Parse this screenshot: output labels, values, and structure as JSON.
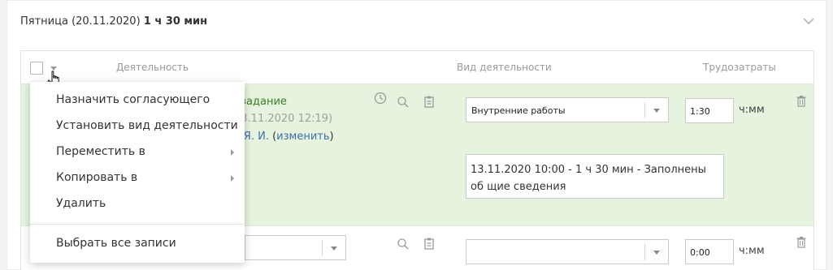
{
  "day": {
    "title_prefix": "Пятница (20.11.2020)",
    "title_total": "1 ч 30 мин"
  },
  "table": {
    "headers": {
      "activity": "Деятельность",
      "activity_type": "Вид деятельности",
      "labor": "Трудозатраты"
    }
  },
  "rows": [
    {
      "task_name_partial": "е задание",
      "task_date_partial": "13.11.2020 12:19)",
      "author_partial": "в Я. И.",
      "author_open_paren": " (",
      "change_link": "изменить",
      "author_close_paren": ")",
      "activity_type_value": "Внутренние работы",
      "time_value": "1:30",
      "time_unit": "ч:мм",
      "note": "13.11.2020 10:00 - 1 ч 30 мин - Заполнены об щие сведения"
    },
    {
      "activity_type_value": "",
      "time_value": "0:00",
      "time_unit": "ч:мм"
    }
  ],
  "context_menu": {
    "items": [
      {
        "label": "Назначить согласующего"
      },
      {
        "label": "Установить вид деятельности"
      },
      {
        "label": "Переместить в",
        "submenu": true
      },
      {
        "label": "Копировать в",
        "submenu": true
      },
      {
        "label": "Удалить"
      }
    ],
    "select_all": "Выбрать все записи"
  },
  "icons": {
    "collapse": "chevron-down-icon",
    "clock": "clock-icon",
    "search": "search-icon",
    "clipboard": "clipboard-icon",
    "trash": "trash-icon",
    "cursor": "hand-cursor-icon"
  },
  "colors": {
    "row_highlight": "#e5f3df",
    "task_name": "#3b7d23",
    "link": "#3d6ea8"
  }
}
